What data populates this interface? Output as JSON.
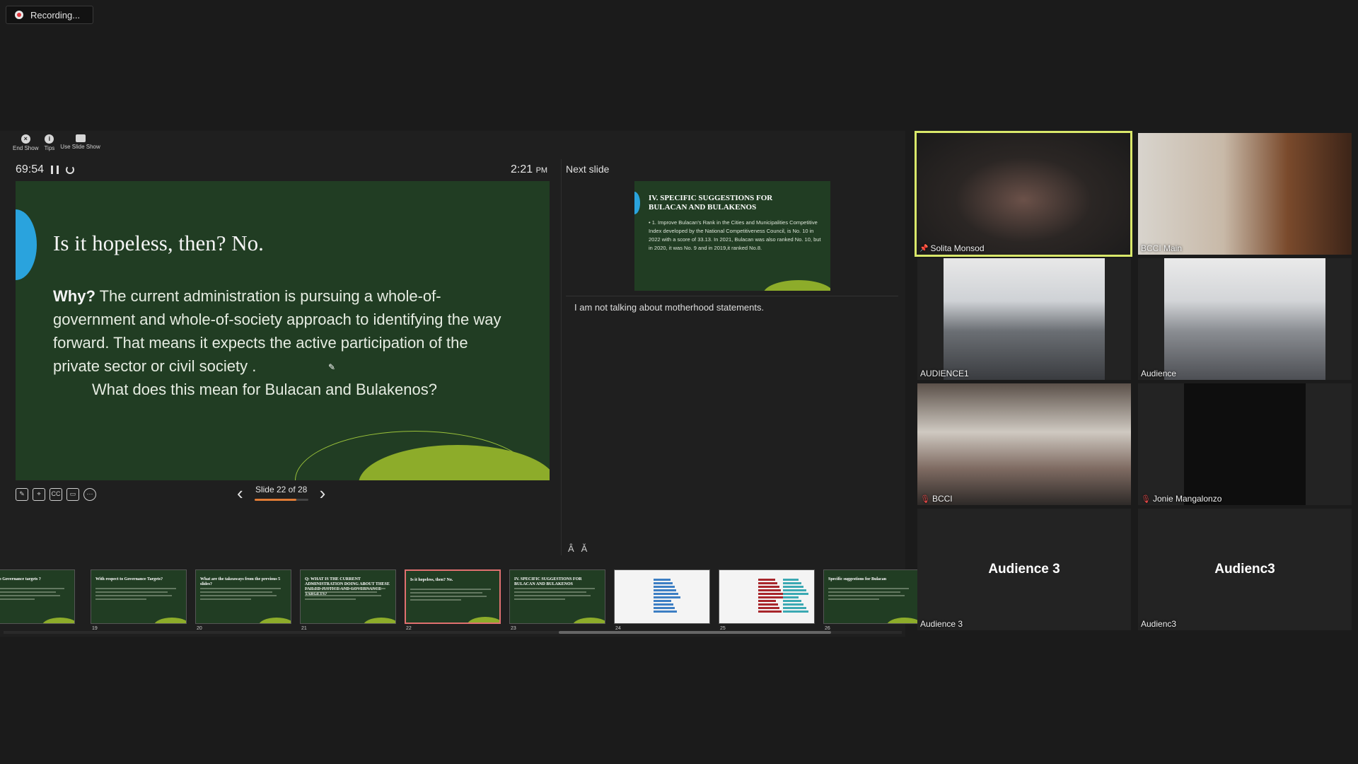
{
  "recording": {
    "label": "Recording..."
  },
  "toolbar": {
    "end_show": "End Show",
    "tips": "Tips",
    "use_slide_show": "Use Slide Show"
  },
  "presenter": {
    "timer": "69:54",
    "clock_time": "2:21",
    "clock_ampm": "PM",
    "slide_indicator": "Slide 22 of 28",
    "slide_progress": 0.786,
    "next_slide_label": "Next slide",
    "notes": "I am not talking about motherhood statements.",
    "font_increase": "Â",
    "font_decrease": "Ǎ"
  },
  "current_slide": {
    "title": "Is it hopeless, then?  No.",
    "why": "Why?",
    "body": " The current administration is pursuing a whole-of-government and whole-of-society approach to identifying the way forward.  That means it expects the active participation of the private sector or civil society .",
    "question": "What does this mean for Bulacan and Bulakenos?"
  },
  "next_slide": {
    "title": "IV. SPECIFIC SUGGESTIONS FOR BULACAN AND BULAKENOS",
    "body": "• 1. Improve Bulacan's Rank in the Cities and Municipalities Competitive Index developed by the National Competitiveness Council, is No. 10 in 2022 with a score of 33.13.  In 2021, Bulacan was also ranked No. 10, but in 2020, it was No. 9 and in 2019,it ranked No.8."
  },
  "thumbnails": [
    {
      "num": "",
      "title": "respect to Governance targets ?",
      "type": "green"
    },
    {
      "num": "19",
      "title": "With respect to Governance Targets?",
      "type": "green"
    },
    {
      "num": "20",
      "title": "What are the takeaways from the previous 5 slides?",
      "type": "green"
    },
    {
      "num": "21",
      "title": "Q: WHAT IS THE CURRENT ADMINISTRATION DOING ABOUT THESE FAILED JUSTICE AND GOVERNANCE TARGETS?",
      "type": "green"
    },
    {
      "num": "22",
      "title": "Is it hopeless, then?  No.",
      "type": "green"
    },
    {
      "num": "23",
      "title": "IV. SPECIFIC SUGGESTIONS FOR BULACAN AND BULAKENOS",
      "type": "green"
    },
    {
      "num": "24",
      "title": "",
      "type": "chart-blue"
    },
    {
      "num": "25",
      "title": "",
      "type": "chart-red"
    },
    {
      "num": "26",
      "title": "Specific suggestions for Bulacan",
      "type": "green"
    }
  ],
  "participants": [
    {
      "name": "Solita Monsod",
      "muted": false,
      "pinned": true,
      "active": true
    },
    {
      "name": "BCCI Main",
      "muted": false,
      "pinned": false,
      "active": false
    },
    {
      "name": "AUDIENCE1",
      "muted": false,
      "pinned": false,
      "active": false
    },
    {
      "name": "Audience",
      "muted": false,
      "pinned": false,
      "active": false
    },
    {
      "name": "BCCI",
      "muted": true,
      "pinned": false,
      "active": false
    },
    {
      "name": "Jonie Mangalonzo",
      "muted": true,
      "pinned": false,
      "active": false
    },
    {
      "name": "Audience 3",
      "muted": false,
      "pinned": false,
      "active": false,
      "placeholder": "Audience 3"
    },
    {
      "name": "Audienc3",
      "muted": false,
      "pinned": false,
      "active": false,
      "placeholder": "Audienc3"
    }
  ],
  "colors": {
    "slide_bg": "#213d23",
    "accent_blue": "#2aa3dd",
    "leaf_green": "#8dac2a",
    "active_speaker": "#d9e86a",
    "active_thumb": "#e07070",
    "progress": "#e07b35"
  }
}
